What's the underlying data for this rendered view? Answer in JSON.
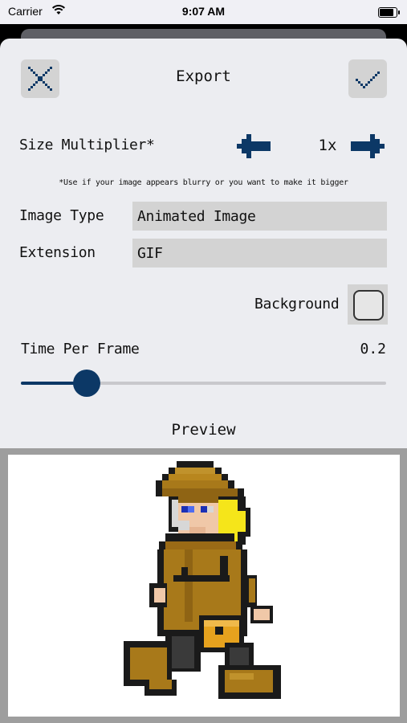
{
  "status": {
    "carrier": "Carrier",
    "time": "9:07 AM"
  },
  "header": {
    "title": "Export",
    "close_icon": "close-x-icon",
    "confirm_icon": "checkmark-icon"
  },
  "size_multiplier": {
    "label": "Size Multiplier*",
    "value": "1x",
    "note": "*Use if your image appears blurry or you want to make it bigger"
  },
  "image_type": {
    "label": "Image Type",
    "value": "Animated Image"
  },
  "extension": {
    "label": "Extension",
    "value": "GIF"
  },
  "background": {
    "label": "Background",
    "checked": false
  },
  "time_per_frame": {
    "label": "Time Per Frame",
    "value": "0.2",
    "fraction": 0.18
  },
  "preview": {
    "label": "Preview"
  },
  "colors": {
    "accent": "#0c3866",
    "panel": "#ecedf1",
    "field": "#d3d3d3",
    "preview_border": "#9e9e9e"
  }
}
